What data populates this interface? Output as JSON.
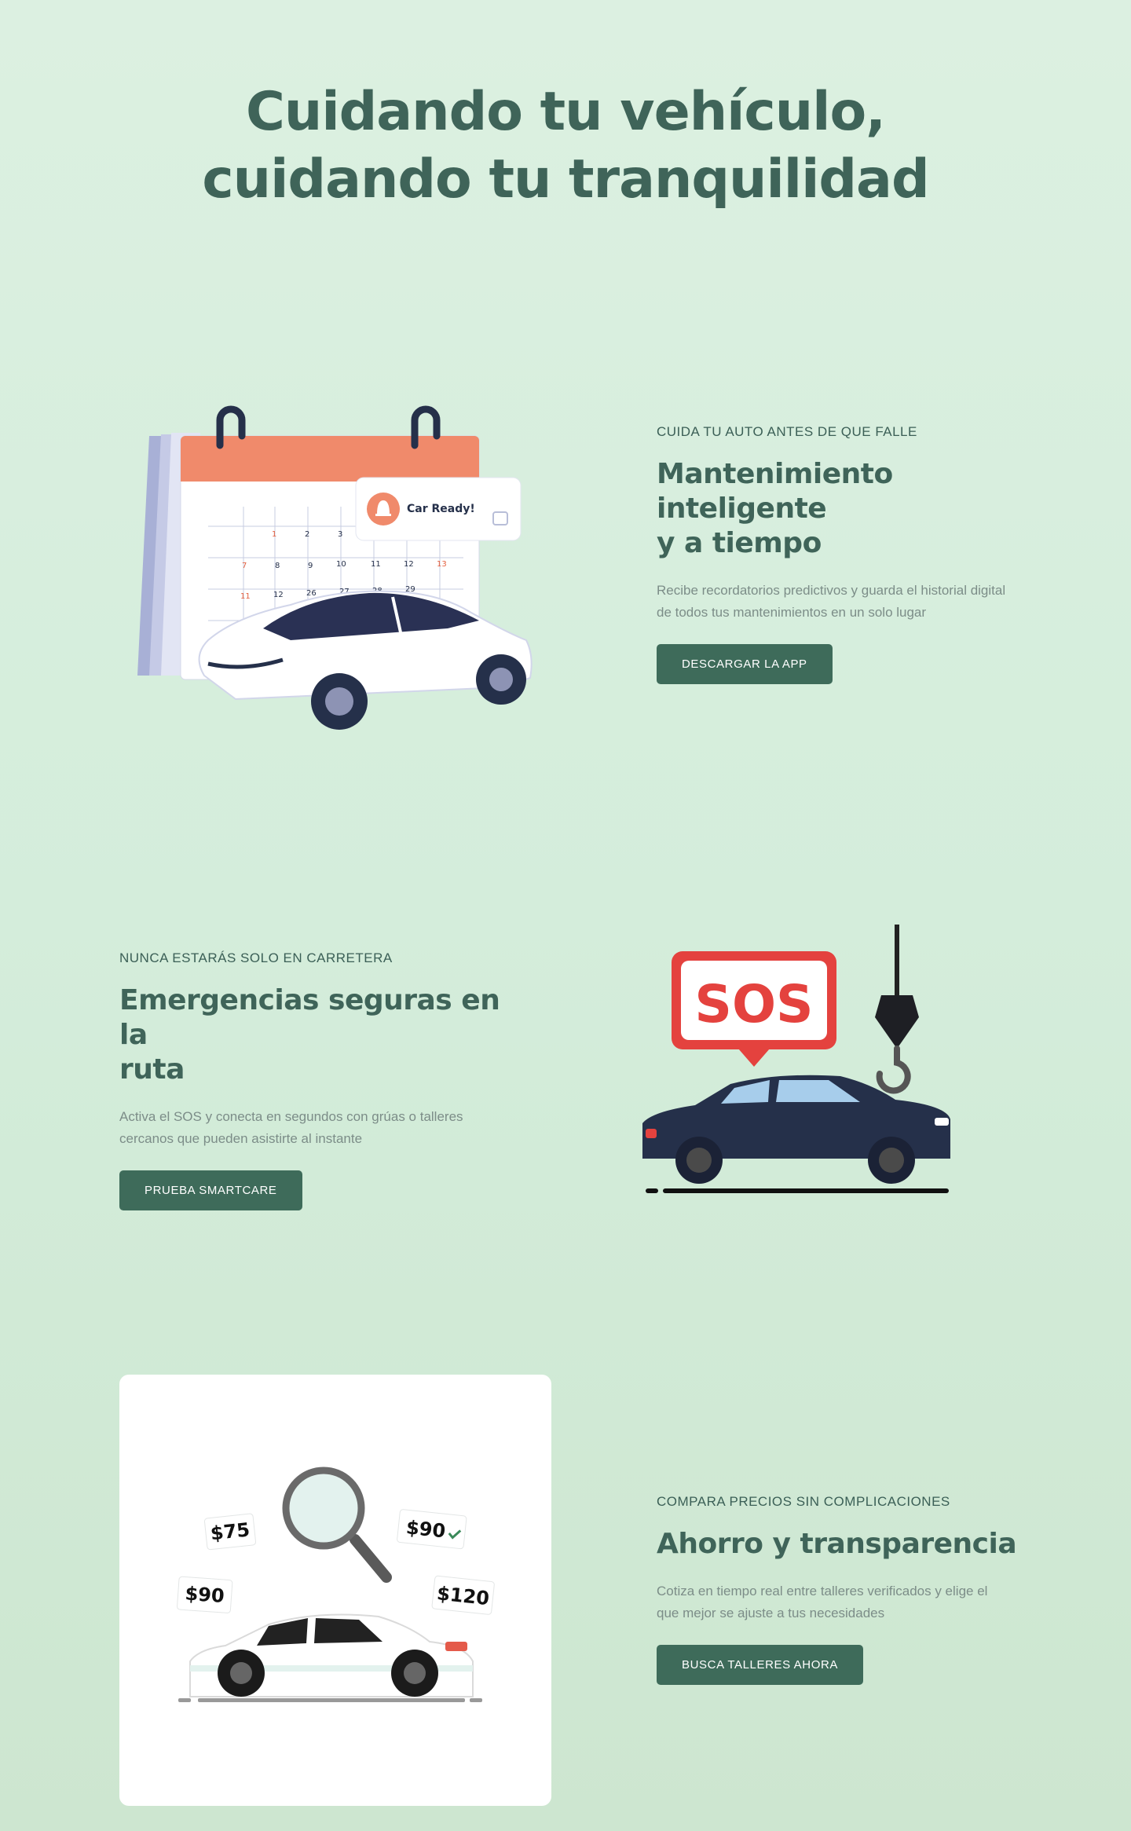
{
  "hero": {
    "line1": "Cuidando tu vehículo,",
    "line2": "cuidando tu tranquilidad"
  },
  "sections": [
    {
      "eyebrow": "CUIDA TU AUTO ANTES DE QUE FALLE",
      "title_line1": "Mantenimiento inteligente",
      "title_line2": "y a tiempo",
      "description_line1": "Recibe recordatorios predictivos y guarda el historial digital",
      "description_line2": "de todos tus mantenimientos en un solo lugar",
      "button": "DESCARGAR LA APP"
    },
    {
      "eyebrow": "NUNCA ESTARÁS SOLO EN CARRETERA",
      "title_line1": "Emergencias seguras en la",
      "title_line2": "ruta",
      "description_line1": "Activa el SOS y conecta en segundos con grúas o talleres",
      "description_line2": "cercanos que pueden asistirte al instante",
      "button": "PRUEBA SMARTCARE"
    },
    {
      "eyebrow": "COMPARA PRECIOS SIN COMPLICACIONES",
      "title_line1": "Ahorro y transparencia",
      "description_line1": "Cotiza en tiempo real entre talleres verificados y elige el",
      "description_line2": "que mejor se ajuste a tus necesidades",
      "button": "BUSCA TALLERES AHORA"
    }
  ],
  "illustration1": {
    "notification": "Car Ready!",
    "calendar_days": [
      "1",
      "2",
      "3",
      "7",
      "8",
      "9",
      "10",
      "11",
      "12",
      "13",
      "11",
      "12",
      "26",
      "27",
      "28",
      "29",
      "26"
    ]
  },
  "illustration2": {
    "sos_label": "SOS"
  },
  "illustration3": {
    "prices": [
      "$75",
      "$90",
      "$90",
      "$120"
    ]
  },
  "colors": {
    "accent": "#3e6b5a",
    "heading": "#3f6459",
    "calendar_top": "#f08a6b",
    "sos_red": "#e4423e",
    "car_navy": "#25304a"
  }
}
